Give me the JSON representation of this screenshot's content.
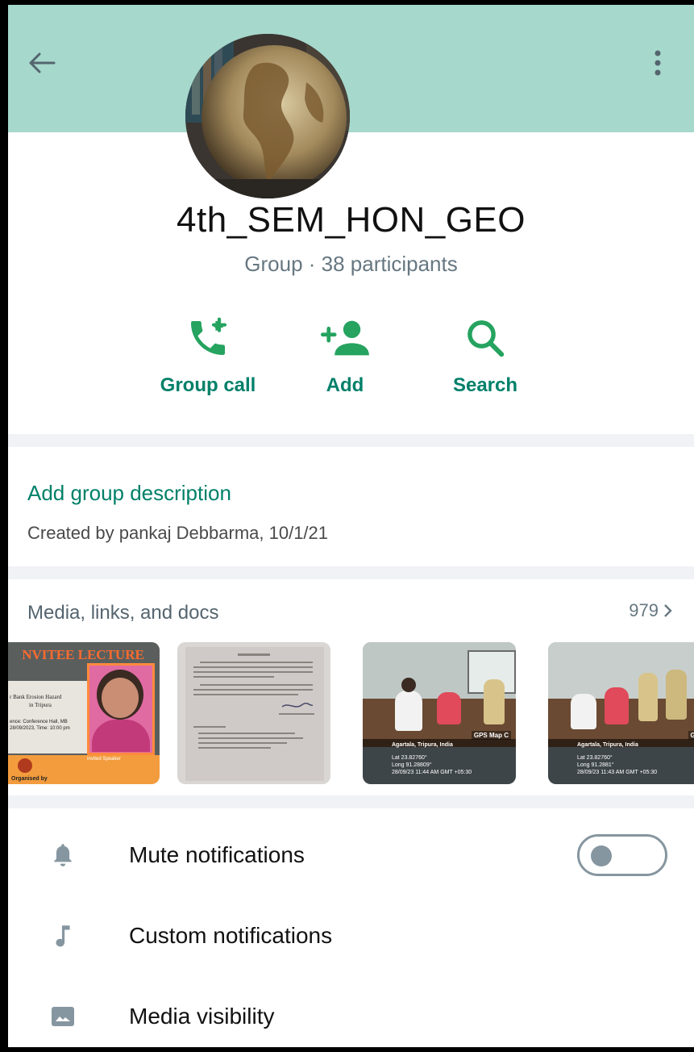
{
  "group": {
    "name": "4th_SEM_HON_GEO",
    "subtitle": "Group · 38 participants"
  },
  "actions": [
    {
      "label": "Group call",
      "icon": "add-call-icon"
    },
    {
      "label": "Add",
      "icon": "add-person-icon"
    },
    {
      "label": "Search",
      "icon": "search-icon"
    }
  ],
  "description": {
    "link": "Add group description",
    "created": "Created by pankaj Debbarma, 10/1/21"
  },
  "media": {
    "title": "Media, links, and docs",
    "count": "979",
    "thumbnails": [
      {
        "header": "NVITEE LECTURE",
        "lines": [
          "r Bank Erosion Hazard",
          "in Tripura"
        ],
        "venue": "ence: Conference Hall, MB",
        "date": "28/09/2023, Time: 10:00 pm",
        "organised": "Organised by",
        "speaker_label": "Invited Speaker"
      },
      {
        "type": "document"
      },
      {
        "overlay": [
          "Agartala, Tripura, India",
          "Lat 23.82760°",
          "Long 91.28809°",
          "28/09/23 11:44 AM GMT +05:30"
        ],
        "badge": "GPS Map C"
      },
      {
        "overlay": [
          "Agartala, Tripura, India",
          "Lat 23.82760°",
          "Long 91.2881°",
          "28/09/23 11:43 AM GMT +05:30"
        ],
        "badge": "Gl"
      }
    ]
  },
  "settings": [
    {
      "label": "Mute notifications",
      "icon": "bell-icon",
      "toggle": false
    },
    {
      "label": "Custom notifications",
      "icon": "music-note-icon"
    },
    {
      "label": "Media visibility",
      "icon": "image-icon"
    }
  ],
  "colors": {
    "accent": "#008069",
    "header": "#a6d8cc",
    "action_icon": "#25a35f"
  }
}
